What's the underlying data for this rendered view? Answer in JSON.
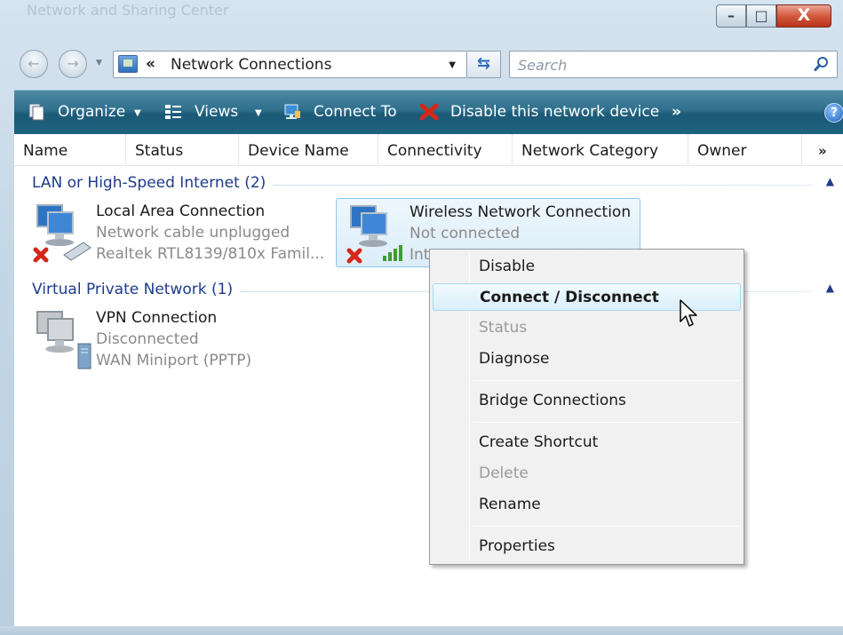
{
  "window": {
    "title": "Network and Sharing Center",
    "buttons": {
      "minimize": "–",
      "maximize": "□",
      "close": "X"
    }
  },
  "nav": {
    "back_glyph": "←",
    "forward_glyph": "→",
    "address_chevron": "«",
    "address": "Network Connections",
    "refresh_glyph": "⇆",
    "search_placeholder": "Search"
  },
  "toolbar": {
    "organize": "Organize",
    "views": "Views",
    "connect_to": "Connect To",
    "disable": "Disable this network device",
    "more": "»",
    "help": "?"
  },
  "columns": [
    "Name",
    "Status",
    "Device Name",
    "Connectivity",
    "Network Category",
    "Owner"
  ],
  "columns_more": "»",
  "groups": [
    {
      "label": "LAN or High-Speed Internet (2)",
      "items": [
        {
          "name": "Local Area Connection",
          "status": "Network cable unplugged",
          "device": "Realtek RTL8139/810x Famil..."
        },
        {
          "name": "Wireless Network Connection",
          "status": "Not connected",
          "device": "Int"
        }
      ]
    },
    {
      "label": "Virtual Private Network (1)",
      "items": [
        {
          "name": "VPN Connection",
          "status": "Disconnected",
          "device": "WAN Miniport (PPTP)"
        }
      ]
    }
  ],
  "context_menu": {
    "items": [
      "Disable",
      "Connect / Disconnect",
      "Status",
      "Diagnose",
      "Bridge Connections",
      "Create Shortcut",
      "Delete",
      "Rename",
      "Properties"
    ],
    "highlighted": "Connect / Disconnect",
    "disabled": [
      "Status",
      "Delete"
    ]
  },
  "colors": {
    "toolbar": "#1f6380",
    "group_header": "#1e3b8a",
    "selection": "#dcedf9",
    "error_x": "#d62718",
    "signal": "#3f9d2f"
  }
}
